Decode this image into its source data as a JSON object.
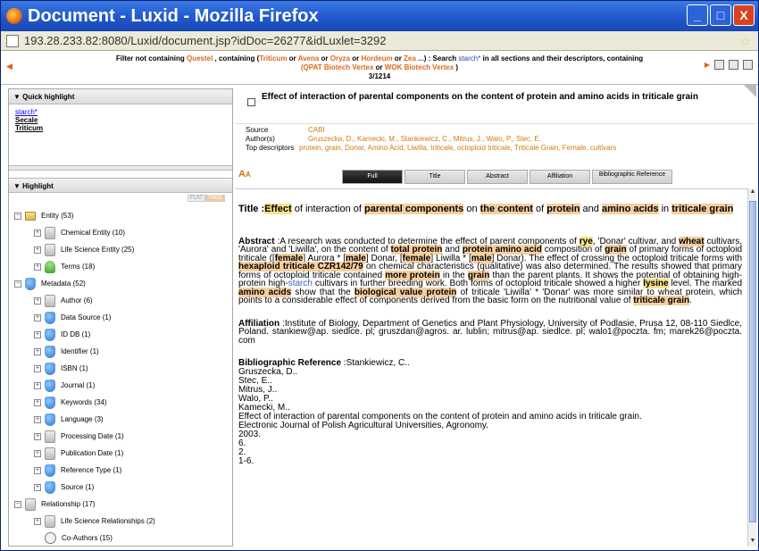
{
  "window": {
    "title": "Document - Luxid - Mozilla Firefox",
    "minimize_label": "_",
    "maximize_label": "□",
    "close_label": "X"
  },
  "address": {
    "url": "193.28.233.82:8080/Luxid/document.jsp?idDoc=26277&idLuxlet=3292"
  },
  "filter": {
    "p1": "Filter not containing ",
    "questel": "Questel",
    "p2": " , containing (",
    "triticum": "Triticum",
    "or1": " or ",
    "avena": "Avena",
    "or2": " or ",
    "oryza": "Oryza",
    "or3": " or ",
    "hordeum": "Hordeum",
    "or4": " or ",
    "zea": "Zea",
    "more": " ...",
    "p3": ") : ",
    "search_label": "Search",
    "search_term": " starch*",
    "p4": " in all sections and their descriptors, containing",
    "sources": "(QPAT Biotech Vertex",
    "or5": " or ",
    "wok": "WOK Biotech Vertex",
    "p5": " )",
    "counter": "3/1214"
  },
  "quick_highlight": {
    "header": "▼ Quick highlight",
    "items": [
      "starch*",
      "Secale",
      "Triticum"
    ]
  },
  "highlight": {
    "header": "▼ Highlight",
    "tool_flat": "FLAT",
    "tool_tree": "TREE",
    "tree": [
      {
        "label": "Entity (53)",
        "indent": 1,
        "icon": "folder",
        "sign": "⊟"
      },
      {
        "label": "Chemical Entity (10)",
        "indent": 2,
        "icon": "grey",
        "sign": "⊞"
      },
      {
        "label": "Life Science Entity (25)",
        "indent": 2,
        "icon": "grey",
        "sign": "⊞"
      },
      {
        "label": "Terms (18)",
        "indent": 2,
        "icon": "green",
        "sign": "⊞"
      },
      {
        "label": "Metadata (52)",
        "indent": 1,
        "icon": "blue",
        "sign": "⊟"
      },
      {
        "label": "Author (6)",
        "indent": 2,
        "icon": "grey",
        "sign": "⊞"
      },
      {
        "label": "Data Source (1)",
        "indent": 2,
        "icon": "blue",
        "sign": "⊞"
      },
      {
        "label": "ID DB (1)",
        "indent": 2,
        "icon": "blue",
        "sign": "⊞"
      },
      {
        "label": "Identifier (1)",
        "indent": 2,
        "icon": "blue",
        "sign": "⊞"
      },
      {
        "label": "ISBN (1)",
        "indent": 2,
        "icon": "blue",
        "sign": "⊞"
      },
      {
        "label": "Journal (1)",
        "indent": 2,
        "icon": "blue",
        "sign": "⊞"
      },
      {
        "label": "Keywords (34)",
        "indent": 2,
        "icon": "blue",
        "sign": "⊞"
      },
      {
        "label": "Language (3)",
        "indent": 2,
        "icon": "blue",
        "sign": "⊞"
      },
      {
        "label": "Processing Date (1)",
        "indent": 2,
        "icon": "grey",
        "sign": "⊞"
      },
      {
        "label": "Publication Date (1)",
        "indent": 2,
        "icon": "grey",
        "sign": "⊞"
      },
      {
        "label": "Reference Type (1)",
        "indent": 2,
        "icon": "blue",
        "sign": "⊞"
      },
      {
        "label": "Source (1)",
        "indent": 2,
        "icon": "blue",
        "sign": "⊞"
      },
      {
        "label": "Relationship (17)",
        "indent": 1,
        "icon": "grey",
        "sign": "⊟"
      },
      {
        "label": "Life Science Relationships (2)",
        "indent": 2,
        "icon": "grey",
        "sign": "⊞"
      },
      {
        "label": "Co-Authors (15)",
        "indent": 2,
        "icon": "ring",
        "sign": ""
      }
    ]
  },
  "doc": {
    "title": "Effect of interaction of parental components on the content of protein and amino acids in triticale grain",
    "source_label": "Source",
    "source": "CABI",
    "authors_label": "Author(s)",
    "authors": "Gruszecka, D., Kamecki, M., Stankiewicz, C., Mitrus, J., Walo, P., Stec, E.",
    "descriptors_label": "Top descriptors",
    "descriptors": "protein, grain, Donar, Amino Acid, Liwilla, triticale, octoploid triticale, Triticale Grain, Female, cultivars"
  },
  "tabs": [
    "Full",
    "Title",
    "Abstract",
    "Affiliation",
    "Bibliographic Reference"
  ],
  "content": {
    "title_label": "Title :",
    "title_parts": [
      "Effect",
      " of interaction of ",
      "parental components",
      " on ",
      "the content",
      " of ",
      "protein",
      " and ",
      "amino acids",
      " in ",
      "triticale grain"
    ],
    "abstract_label": "Abstract",
    "abstract": [
      " :A research was conducted to determine the effect of parent components of ",
      "rye",
      ", 'Donar' cultivar, and ",
      "wheat",
      " cultivars, 'Aurora' and 'Liwilla', on the content of ",
      "total protein",
      " and ",
      "protein amino acid",
      " composition of ",
      "grain",
      " of primary forms of octoploid triticale ([",
      "female",
      "] Aurora * [",
      "male",
      "] Donar, [",
      "female",
      "] Liwilla * [",
      "male",
      "] Donar). The effect of crossing the octoploid triticale forms with ",
      "hexaploid triticale CZR142/79",
      " on chemical characteristics (qualitative) was also determined. The results showed that primary forms of octoploid triticale contained ",
      "more protein",
      " in the ",
      "grain",
      " than the parent plants. It shows the potential of obtaining high-protein high-",
      "starch",
      " cultivars in further breeding work. Both forms of octoploid triticale showed a higher ",
      "lysine",
      " level. The marked ",
      "amino acids",
      " show that the ",
      "biological value protein",
      " of triticale 'Liwilla' * 'Donar' was more similar to wheat protein, which points to a considerable effect of components derived from the basic form on the nutritional value of ",
      "triticale grain",
      "."
    ],
    "affiliation_label": "Affiliation",
    "affiliation": " :Institute of Biology, Department of Genetics and Plant Physiology, University of Podlasie, Prusa 12, 08-110 Siedlce, Poland. stankiew@ap. siedlce. pl; gruszdan@agros. ar. lublin; mitrus@ap. siedlce. pl; walo1@poczta. fm; marek26@poczta. com",
    "bib_label": "Bibliographic Reference",
    "bib_first": " :Stankiewicz, C..",
    "bib_lines": [
      "Gruszecka, D..",
      "Stec, E..",
      "Mitrus, J..",
      "Walo, P..",
      "Kamecki, M..",
      "Effect of interaction of parental components on the content of protein and amino acids in triticale grain.",
      "Electronic Journal of Polish Agricultural Universities, Agronomy.",
      "2003.",
      "6.",
      "2.",
      "1-6."
    ]
  }
}
